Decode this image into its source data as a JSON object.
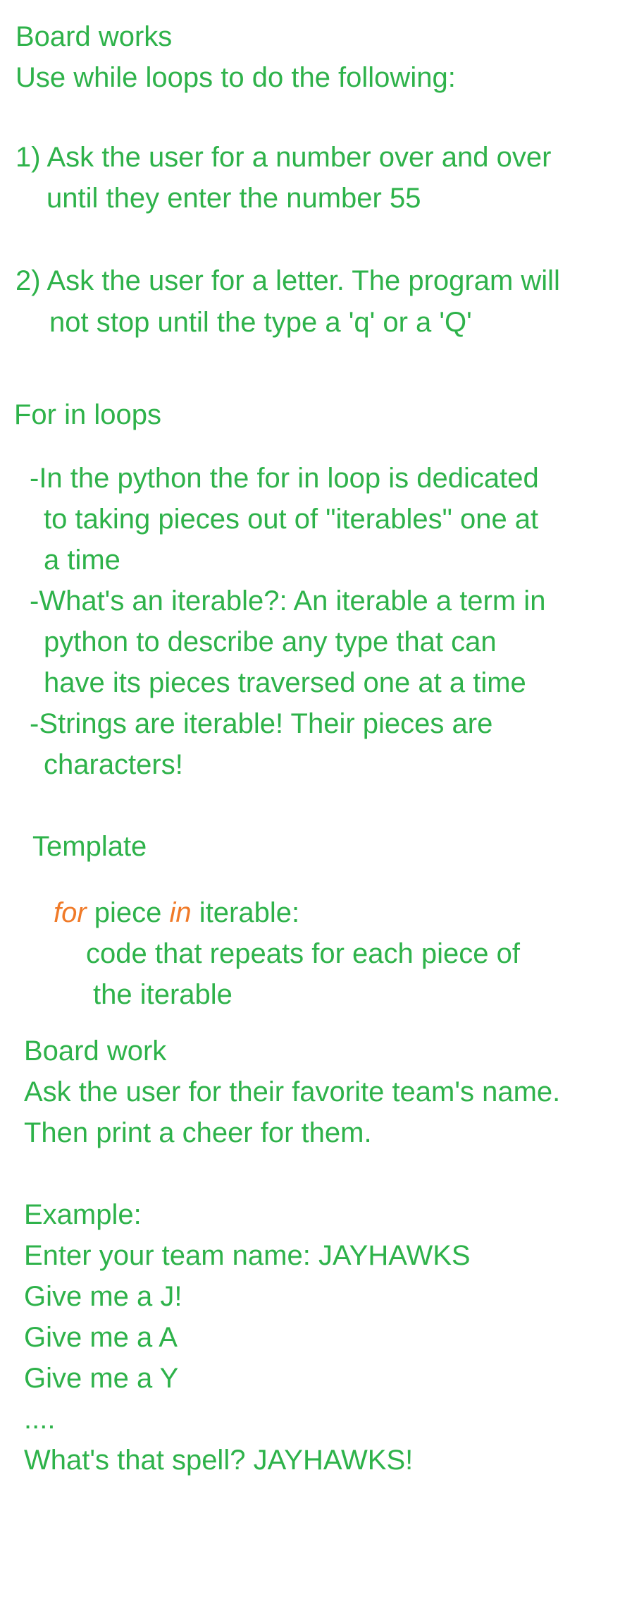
{
  "section1": {
    "title": "Board works",
    "intro": "Use while loops to do the following:",
    "item1_line1": "1) Ask the user for a number over and over",
    "item1_line2": "until they enter the number 55",
    "item2_line1": "2) Ask the user for a letter. The program will",
    "item2_line2": "not stop until the type a 'q' or a 'Q'"
  },
  "section2": {
    "title": "For in loops",
    "bullet1_line1": "-In the python the for in loop is dedicated",
    "bullet1_line2": "to taking pieces out of \"iterables\" one at",
    "bullet1_line3": "a time",
    "bullet2_line1": "-What's an iterable?: An iterable a term in",
    "bullet2_line2": "python to describe any type that can",
    "bullet2_line3": "have its pieces traversed one at a time",
    "bullet3_line1": "-Strings are iterable! Their pieces are",
    "bullet3_line2": "characters!"
  },
  "template": {
    "title": "Template",
    "kw_for": "for",
    "piece": " piece ",
    "kw_in": "in",
    "iterable": " iterable:",
    "body_line1": "code that repeats for each piece of",
    "body_line2": "the iterable"
  },
  "section3": {
    "title": "Board work",
    "line1": "Ask the user for their favorite team's name.",
    "line2": "Then print a cheer for them.",
    "example_label": "Example:",
    "example_lines": [
      "Enter your team name: JAYHAWKS",
      "Give me a J!",
      "Give me a A",
      "Give me a Y",
      "....",
      "What's that spell? JAYHAWKS!"
    ]
  },
  "colors": {
    "text_green": "#2eb24a",
    "keyword_orange": "#f07a28",
    "background": "#ffffff"
  }
}
